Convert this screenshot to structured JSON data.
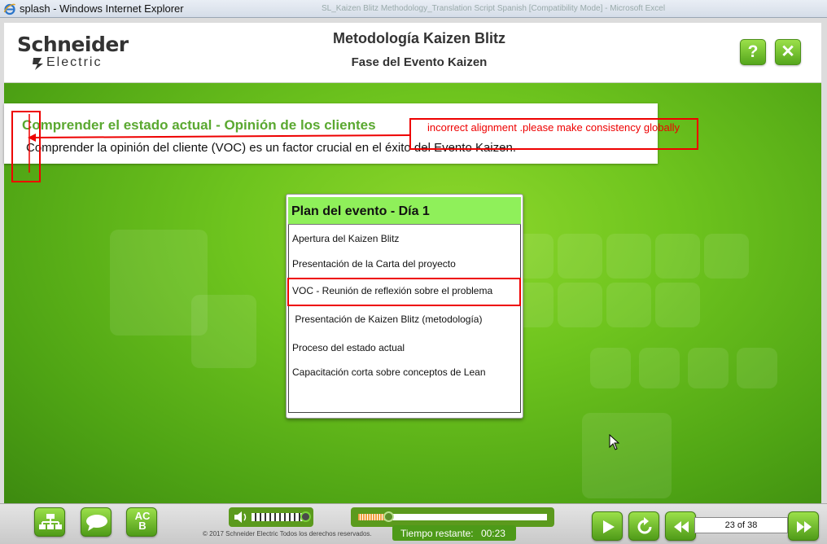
{
  "window": {
    "title": "splash - Windows Internet Explorer",
    "background_tab_text": "SL_Kaizen Blitz Methodology_Translation Script Spanish  [Compatibility Mode] - Microsoft Excel"
  },
  "header": {
    "logo_line1": "Schneider",
    "logo_line2": "Electric",
    "course_title": "Metodología Kaizen Blitz",
    "course_subtitle": "Fase del Evento Kaizen",
    "help_label": "?",
    "close_label": "✕"
  },
  "banner": {
    "heading": "Comprender el estado actual - Opinión de los clientes",
    "description": "Comprender la opinión del cliente (VOC) es un factor crucial en el éxito del Evento Kaizen."
  },
  "annotation": {
    "text": "incorrect alignment .please make consistency globally",
    "color": "#e00000"
  },
  "plan": {
    "title": "Plan del evento - Día 1",
    "items": [
      "Apertura del Kaizen Blitz",
      "Presentación de la Carta del proyecto",
      "VOC - Reunión de reflexión sobre el problema",
      " Presentación de Kaizen Blitz (metodología)",
      "Proceso del estado actual",
      "Capacitación corta sobre conceptos de Lean"
    ],
    "highlighted_item_index": 2
  },
  "footer": {
    "copyright": "© 2017 Schneider Electric Todos los derechos reservados.",
    "timer_label": "Tiempo restante:",
    "timer_value": "00:23",
    "page_indicator": "23 of 38",
    "abc_label_line1": "AC",
    "abc_label_line2": "B",
    "volume_level_fraction": 0.92,
    "progress_fraction": 0.16
  },
  "icons": {
    "sitemap": "sitemap-icon",
    "transcript": "speech-bubble-icon",
    "glossary": "abc-glossary-icon",
    "volume": "speaker-icon",
    "play": "play-icon",
    "replay": "replay-icon",
    "previous": "rewind-icon",
    "next": "fast-forward-icon"
  },
  "colors": {
    "brand_green": "#5aa830",
    "stage_green": "#6ec41e",
    "plan_header": "#8ff05a",
    "annotation_red": "#e00000"
  }
}
